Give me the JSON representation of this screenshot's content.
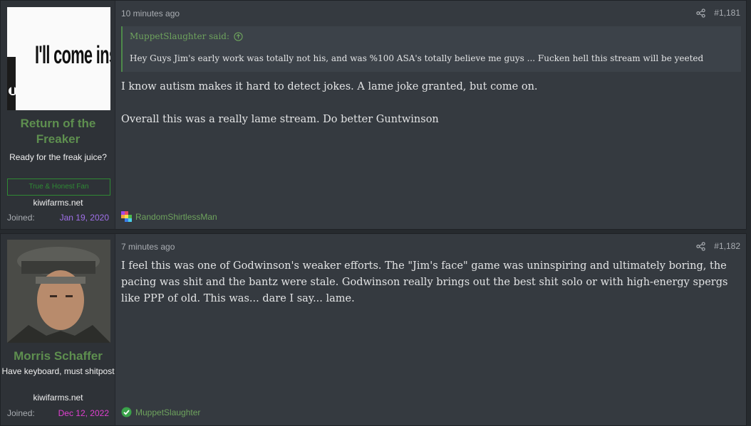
{
  "posts": [
    {
      "avatar_caption": "I'll come inside",
      "username": "Return of the Freaker",
      "user_title": "Ready for the freak juice?",
      "banner": "True & Honest Fan",
      "site": "kiwifarms.net",
      "joined_label": "Joined:",
      "joined_date": "Jan 19, 2020",
      "joined_color": "#a070e8",
      "time": "10 minutes ago",
      "post_number": "#1,181",
      "quote": {
        "author": "MuppetSlaughter said:",
        "text": "Hey Guys Jim's early work was totally not his, and was %100 ASA's totally believe me guys ... Fucken hell this stream will be yeeted"
      },
      "message": [
        "I know autism makes it hard to detect jokes. A lame joke granted, but come on.",
        "Overall this was a really lame stream. Do better Guntwinson"
      ],
      "reaction_icon": "rainbow-pixel-icon",
      "reaction_user": "RandomShirtlessMan"
    },
    {
      "avatar_caption": "",
      "username": "Morris Schaffer",
      "user_title": "Have keyboard, must shitpost",
      "site": "kiwifarms.net",
      "joined_label": "Joined:",
      "joined_date": "Dec 12, 2022",
      "joined_color": "#e040d0",
      "time": "7 minutes ago",
      "post_number": "#1,182",
      "message": [
        "I feel this was one of Godwinson's weaker efforts. The \"Jim's face\" game was uninspiring and ultimately boring, the pacing was shit and the bantz were stale. Godwinson really brings out the best shit solo or with high-energy spergs like PPP of old. This was... dare I say... lame."
      ],
      "reaction_icon": "green-check-icon",
      "reaction_user": "MuppetSlaughter"
    }
  ]
}
